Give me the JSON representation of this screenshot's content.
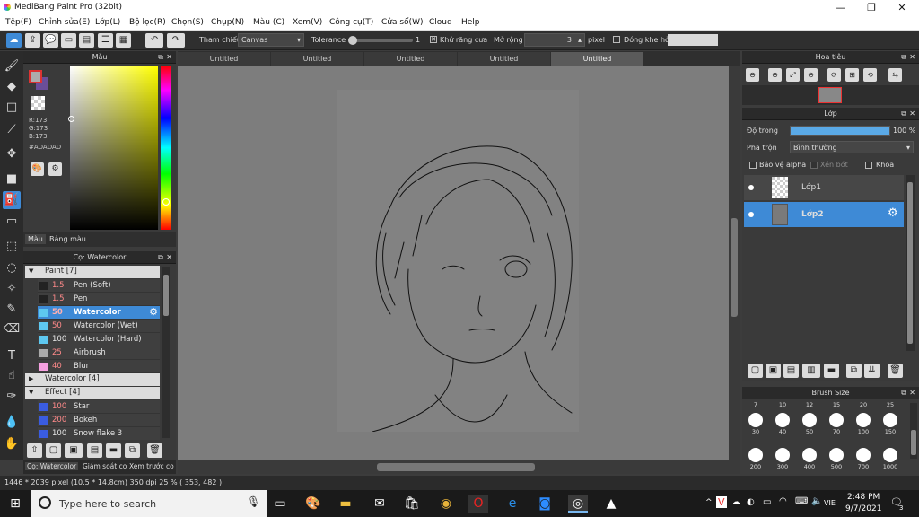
{
  "window": {
    "title": "MediBang Paint Pro (32bit)",
    "minimize": "—",
    "maximize": "❐",
    "close": "✕"
  },
  "menu": [
    "Tệp(F)",
    "Chỉnh sửa(E)",
    "Lớp(L)",
    "Bộ lọc(R)",
    "Chọn(S)",
    "Chụp(N)",
    "Màu (C)",
    "Xem(V)",
    "Công cụ(T)",
    "Cửa sổ(W)",
    "Cloud",
    "Help"
  ],
  "toolbar": {
    "reference_label": "Tham chiếu",
    "reference_value": "Canvas",
    "tolerance_label": "Tolerance",
    "tolerance_value": "1",
    "tolerance_fraction": 0.0,
    "antialias_label": "Khử răng cưa",
    "antialias_checked": true,
    "expand_label": "Mở rộng",
    "expand_value": "3",
    "expand_unit": "pixel",
    "gap_label": "Đóng khe hở",
    "gap_checked": false
  },
  "color_panel": {
    "title": "Màu",
    "r": "R:173",
    "g": "G:173",
    "b": "B:173",
    "hex": "#ADADAD",
    "primary_color": "#ADADAD",
    "tab_color": "Màu",
    "tab_palette": "Bảng màu"
  },
  "brush_panel": {
    "title": "Cọ: Watercolor",
    "groups": [
      {
        "label": "Paint [7]",
        "expanded": true,
        "items": [
          {
            "size": "1.5",
            "name": "Pen (Soft)",
            "swatch": "#222222",
            "selected": false
          },
          {
            "size": "1.5",
            "name": "Pen",
            "swatch": "#222222",
            "selected": false
          },
          {
            "size": "50",
            "name": "Watercolor",
            "swatch": "#5ec8f0",
            "selected": true
          },
          {
            "size": "50",
            "name": "Watercolor (Wet)",
            "swatch": "#5ec8f0",
            "selected": false
          },
          {
            "size": "100",
            "name": "Watercolor (Hard)",
            "swatch": "#5ec8f0",
            "selected": false
          },
          {
            "size": "25",
            "name": "Airbrush",
            "swatch": "#aaaaaa",
            "selected": false
          },
          {
            "size": "40",
            "name": "Blur",
            "swatch": "#f5a0e0",
            "selected": false
          }
        ]
      },
      {
        "label": "Watercolor [4]",
        "expanded": false,
        "items": []
      },
      {
        "label": "Effect [4]",
        "expanded": true,
        "items": [
          {
            "size": "100",
            "name": "Star",
            "swatch": "#3a5ce0",
            "selected": false
          },
          {
            "size": "200",
            "name": "Bokeh",
            "swatch": "#3a5ce0",
            "selected": false
          },
          {
            "size": "100",
            "name": "Snow flake 3",
            "swatch": "#3a5ce0",
            "selected": false
          }
        ]
      }
    ]
  },
  "bottom_tabs": [
    "Cọ: Watercolor",
    "Giám soát co",
    "Xem trước co"
  ],
  "doc_tabs": [
    "Untitled",
    "Untitled",
    "Untitled",
    "Untitled",
    "Untitled"
  ],
  "navigator": {
    "title": "Hoa tiêu"
  },
  "layer_panel": {
    "title": "Lớp",
    "opacity_label": "Độ trong",
    "opacity_value": "100 %",
    "opacity_fraction": 1.0,
    "blend_label": "Pha trộn",
    "blend_value": "Bình thường",
    "protect_alpha": "Bảo vệ alpha",
    "clipping": "Xén bớt",
    "lock": "Khóa",
    "layers": [
      {
        "name": "Lớp1",
        "selected": false
      },
      {
        "name": "Lớp2",
        "selected": true
      }
    ]
  },
  "brush_size": {
    "title": "Brush Size",
    "scale": [
      "7",
      "10",
      "12",
      "15",
      "20",
      "25"
    ],
    "row1": [
      "30",
      "40",
      "50",
      "70",
      "100",
      "150"
    ],
    "row2": [
      "200",
      "300",
      "400",
      "500",
      "700",
      "1000"
    ]
  },
  "status": {
    "info": "1446 * 2039 pixel   (10.5 * 14.8cm)   350 dpi   25 %   ( 353, 482 )"
  },
  "taskbar": {
    "search_placeholder": "Type here to search",
    "lang": "VIE",
    "time": "2:48 PM",
    "date": "9/7/2021",
    "notif": "3"
  },
  "colors": {
    "accent": "#3e8ad6",
    "panel": "#3a3a3a",
    "canvas_bg": "#7d7d7d",
    "paper": "#828282"
  }
}
